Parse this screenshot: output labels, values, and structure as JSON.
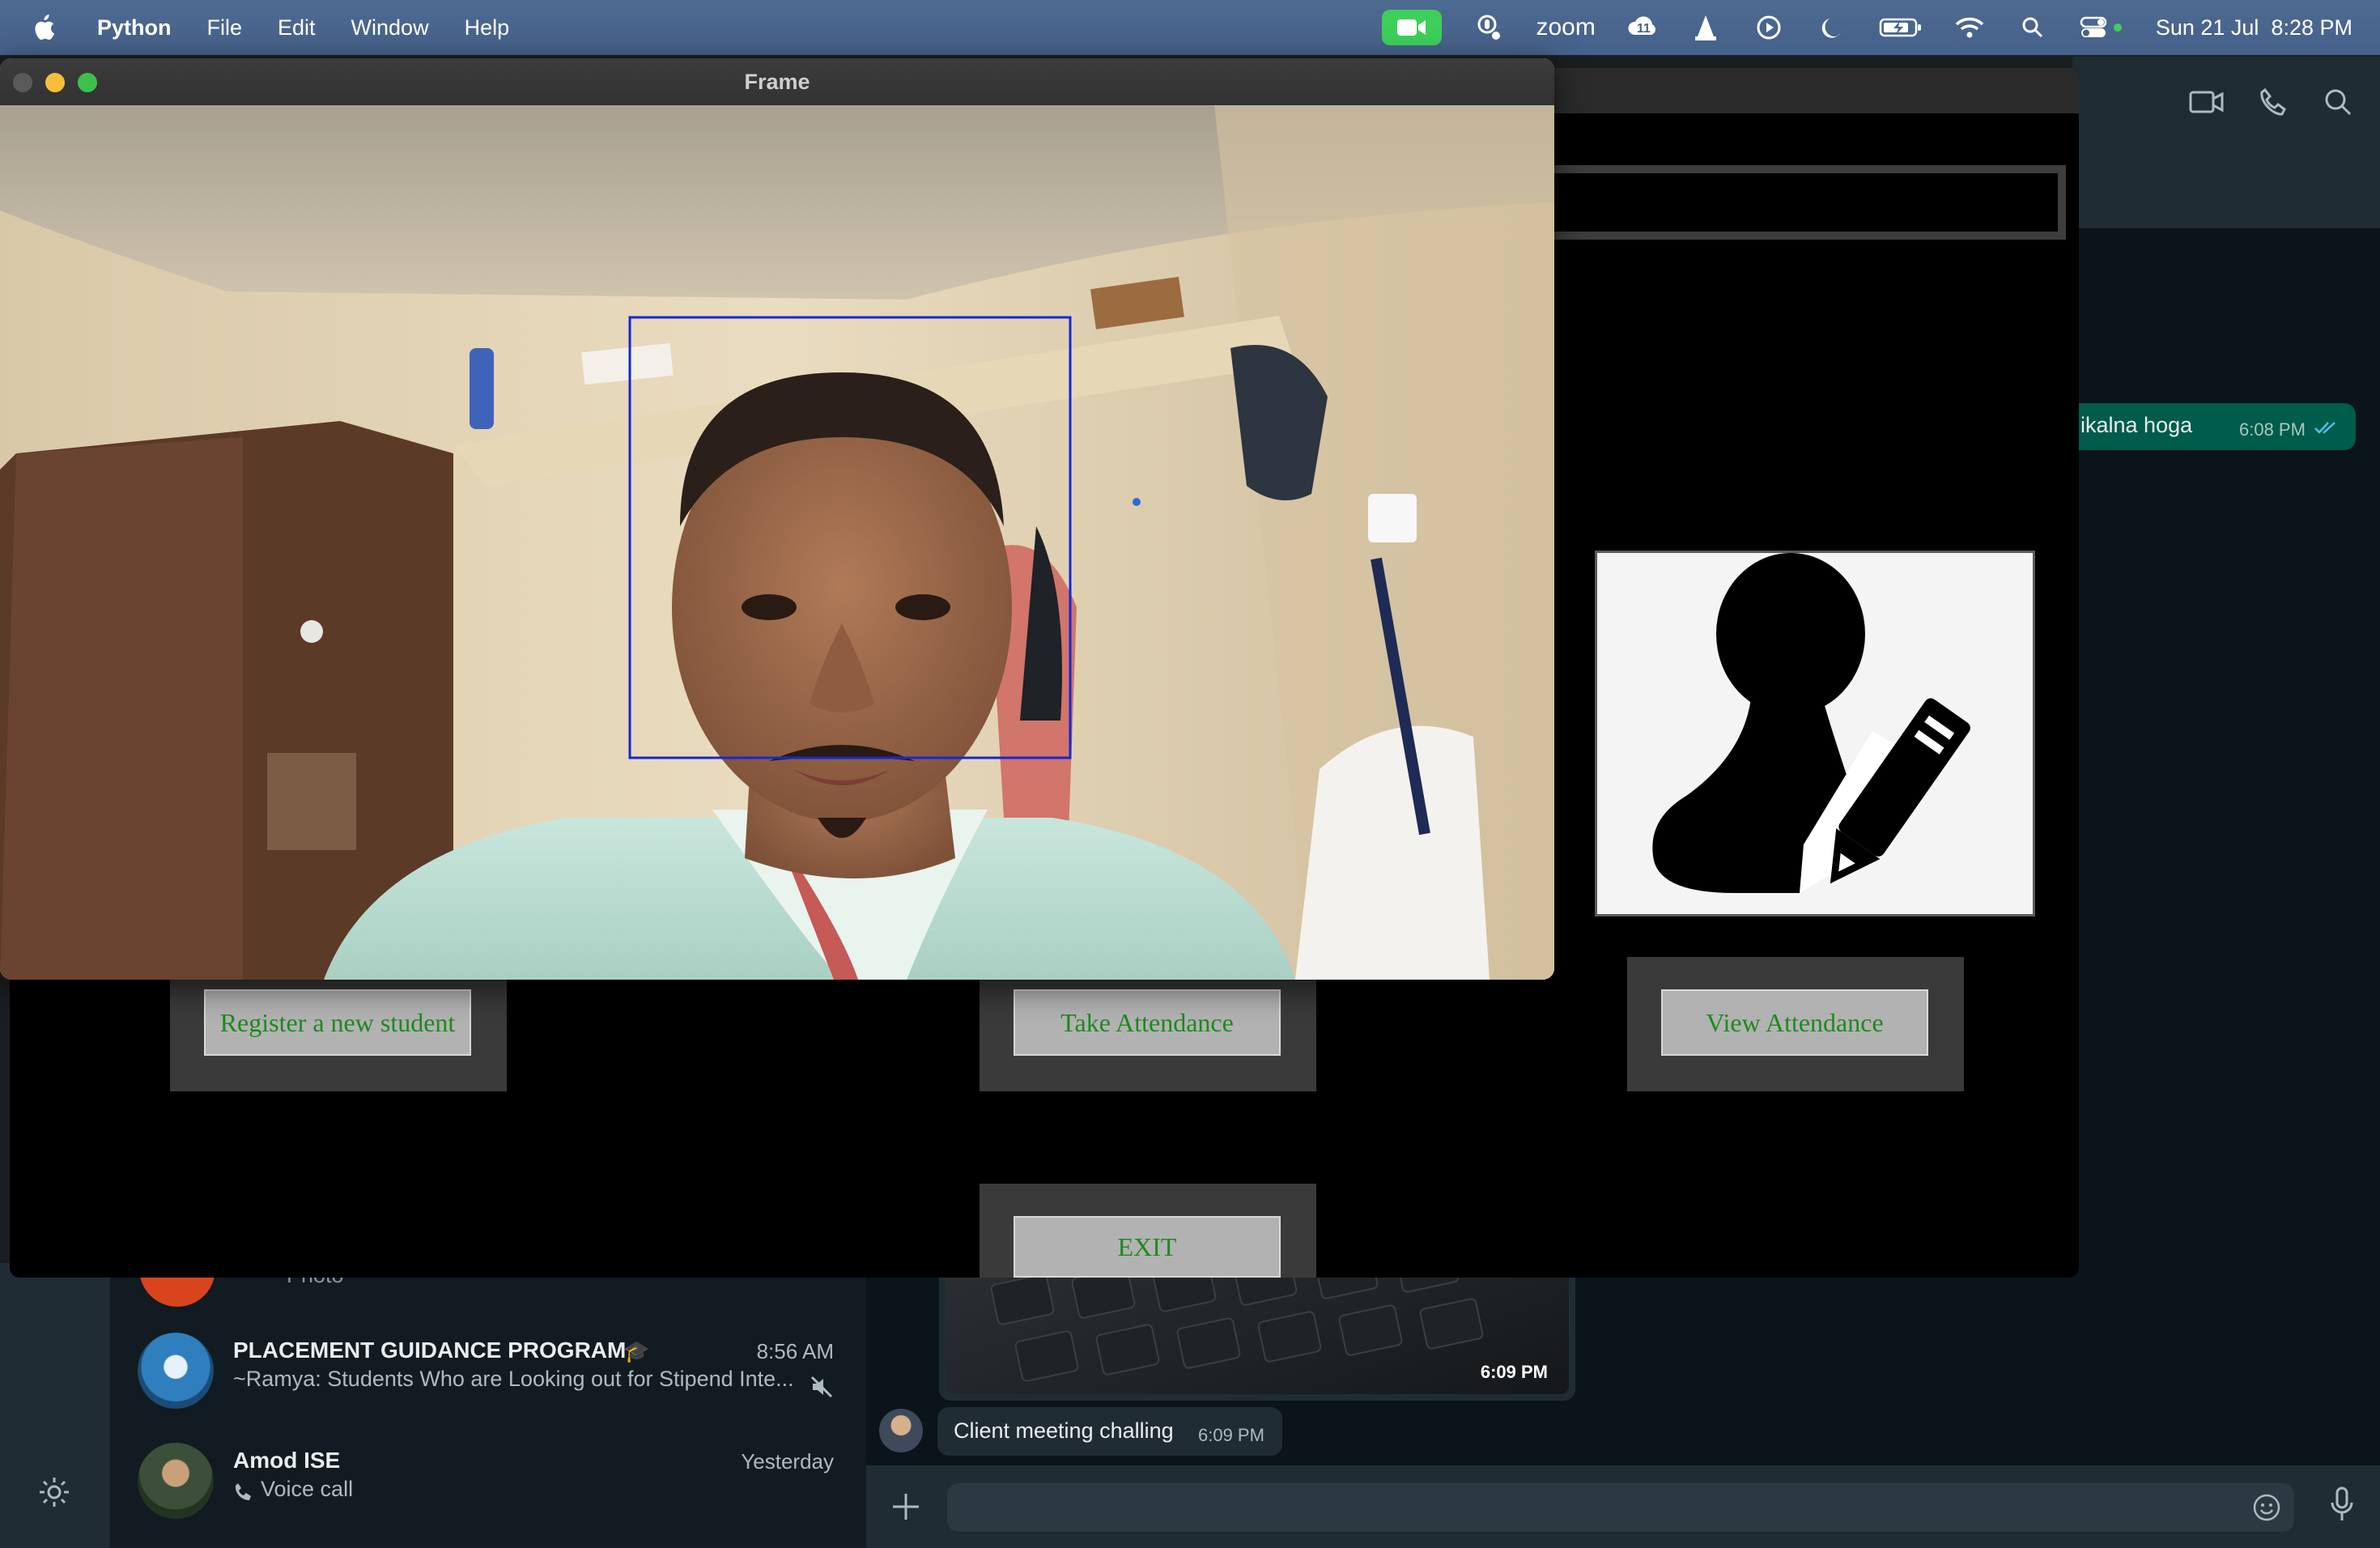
{
  "menubar": {
    "app_name": "Python",
    "menus": [
      "File",
      "Edit",
      "Window",
      "Help"
    ],
    "zoom_label": "zoom",
    "notification_count": "11",
    "datetime": "Sun 21 Jul  8:28 PM"
  },
  "camera_window": {
    "title": "Frame"
  },
  "attendance_app": {
    "buttons": {
      "register": "Register a new student",
      "take": "Take Attendance",
      "view": "View Attendance",
      "exit": "EXIT"
    },
    "button_text_color": "#1d8a1d"
  },
  "whatsapp": {
    "outgoing_message": {
      "text": "ikalna hoga",
      "time": "6:08 PM"
    },
    "photo_time": "6:09 PM",
    "incoming_message": {
      "text": "Client meeting challing",
      "time": "6:09 PM"
    },
    "chats": [
      {
        "title": "PLACEMENT GUIDANCE PROGRAM",
        "preview": "~Ramya: Students Who are Looking out for Stipend Inte...",
        "time": "8:56 AM"
      },
      {
        "title": "Amod ISE",
        "preview": "Voice call",
        "time": "Yesterday"
      }
    ],
    "partial_chat_preview": "Photo"
  }
}
